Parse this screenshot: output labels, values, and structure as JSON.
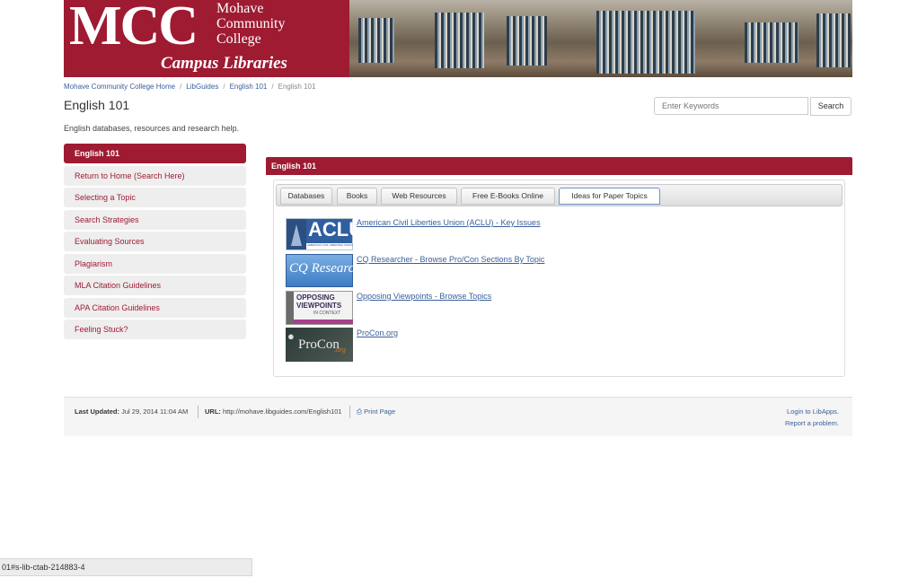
{
  "banner": {
    "logo_letters": "MCC",
    "college_line1": "Mohave",
    "college_line2": "Community",
    "college_line3": "College",
    "subtitle": "Campus Libraries"
  },
  "breadcrumb": {
    "items": [
      "Mohave Community College Home",
      "LibGuides",
      "English 101",
      "English 101"
    ]
  },
  "page": {
    "title": "English 101",
    "description": "English databases, resources and research help."
  },
  "search": {
    "placeholder": "Enter Keywords",
    "button_label": "Search"
  },
  "nav": {
    "items": [
      {
        "label": "English 101",
        "active": true
      },
      {
        "label": "Return to Home (Search Here)"
      },
      {
        "label": "Selecting a Topic"
      },
      {
        "label": "Search Strategies"
      },
      {
        "label": "Evaluating Sources"
      },
      {
        "label": "Plagiarism"
      },
      {
        "label": "MLA Citation Guidelines"
      },
      {
        "label": "APA Citation Guidelines"
      },
      {
        "label": "Feeling Stuck?"
      }
    ]
  },
  "box": {
    "heading": "English 101",
    "tabs": [
      {
        "label": "Databases"
      },
      {
        "label": "Books"
      },
      {
        "label": "Web Resources"
      },
      {
        "label": "Free E-Books Online"
      },
      {
        "label": "Ideas for Paper Topics",
        "active": true
      }
    ],
    "resources": [
      {
        "link": "American Civil Liberties Union (ACLU) - Key Issues",
        "logo_text": "ACLU",
        "logo_sub": "AMERICAN CIVIL LIBERTIES UNION"
      },
      {
        "link": "CQ Researcher - Browse Pro/Con Sections By Topic",
        "logo_text": "CQ Researcher"
      },
      {
        "link": "Opposing Viewpoints - Browse Topics",
        "logo_line1": "OPPOSING",
        "logo_line2": "VIEWPOINTS",
        "logo_line3": "IN CONTEXT"
      },
      {
        "link": "ProCon.org",
        "logo_text": "ProCon",
        "logo_suffix": ".org"
      }
    ]
  },
  "footer": {
    "updated_label": "Last Updated:",
    "updated_value": "Jul 29, 2014 11:04 AM",
    "url_label": "URL:",
    "url_value": "http://mohave.libguides.com/English101",
    "print_label": "Print Page",
    "login_link": "Login to LibApps.",
    "report_link": "Report a problem."
  },
  "status_bar": {
    "text": "01#s-lib-ctab-214883-4"
  },
  "colors": {
    "brand": "#9e1b32",
    "link": "#3a5f9a"
  }
}
